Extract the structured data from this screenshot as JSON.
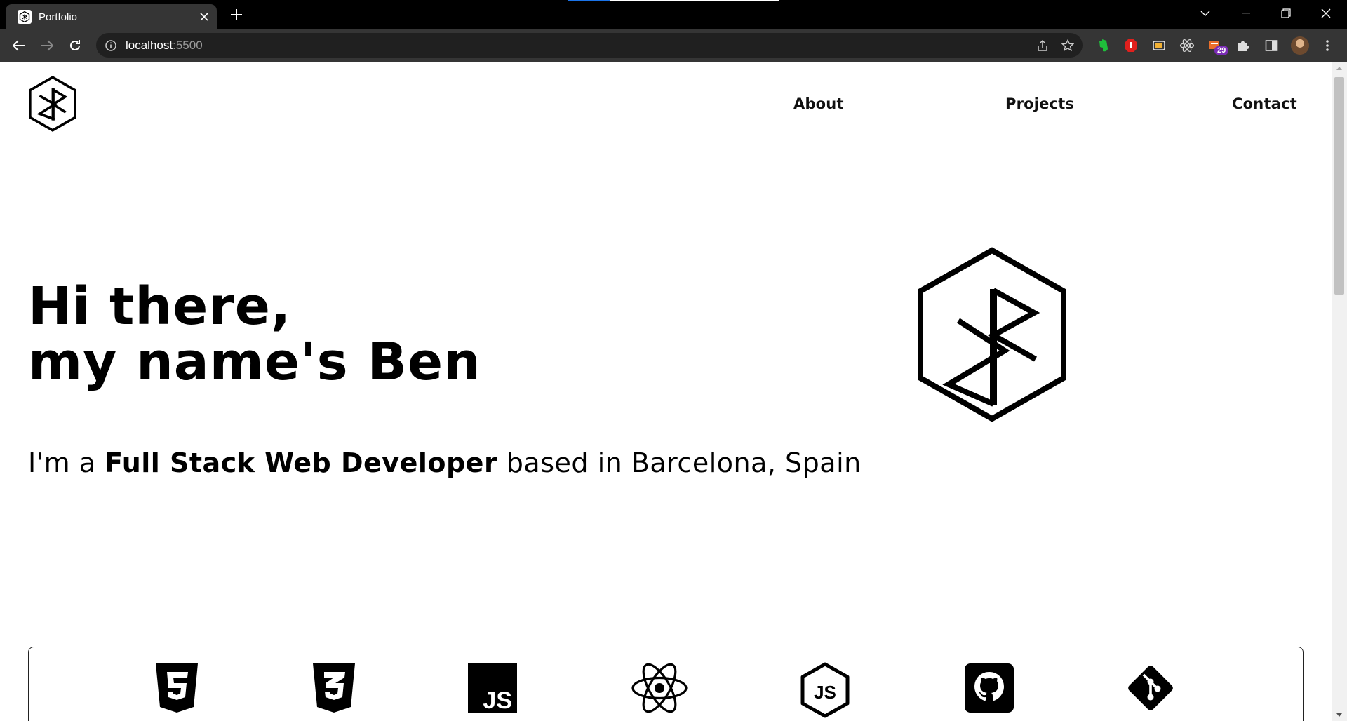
{
  "browser": {
    "tab": {
      "title": "Portfolio"
    },
    "address_bar": {
      "host": "localhost",
      "port": ":5500"
    },
    "extension_badge_count": "29",
    "colors": {
      "chrome_dark": "#000000",
      "toolbar": "#353535",
      "omnibox": "#202020",
      "badge": "#7a2bb5"
    }
  },
  "site": {
    "nav": [
      {
        "label": "About"
      },
      {
        "label": "Projects"
      },
      {
        "label": "Contact"
      }
    ],
    "hero": {
      "line1": "Hi there,",
      "line2_prefix": "my name's ",
      "name": "Ben",
      "tagline_prefix": "I'm a ",
      "role": "Full Stack Web Developer",
      "tagline_suffix": " based in Barcelona, Spain"
    },
    "tech_icons": [
      "html5-icon",
      "css3-icon",
      "javascript-icon",
      "react-icon",
      "nodejs-icon",
      "github-icon",
      "git-icon"
    ]
  }
}
